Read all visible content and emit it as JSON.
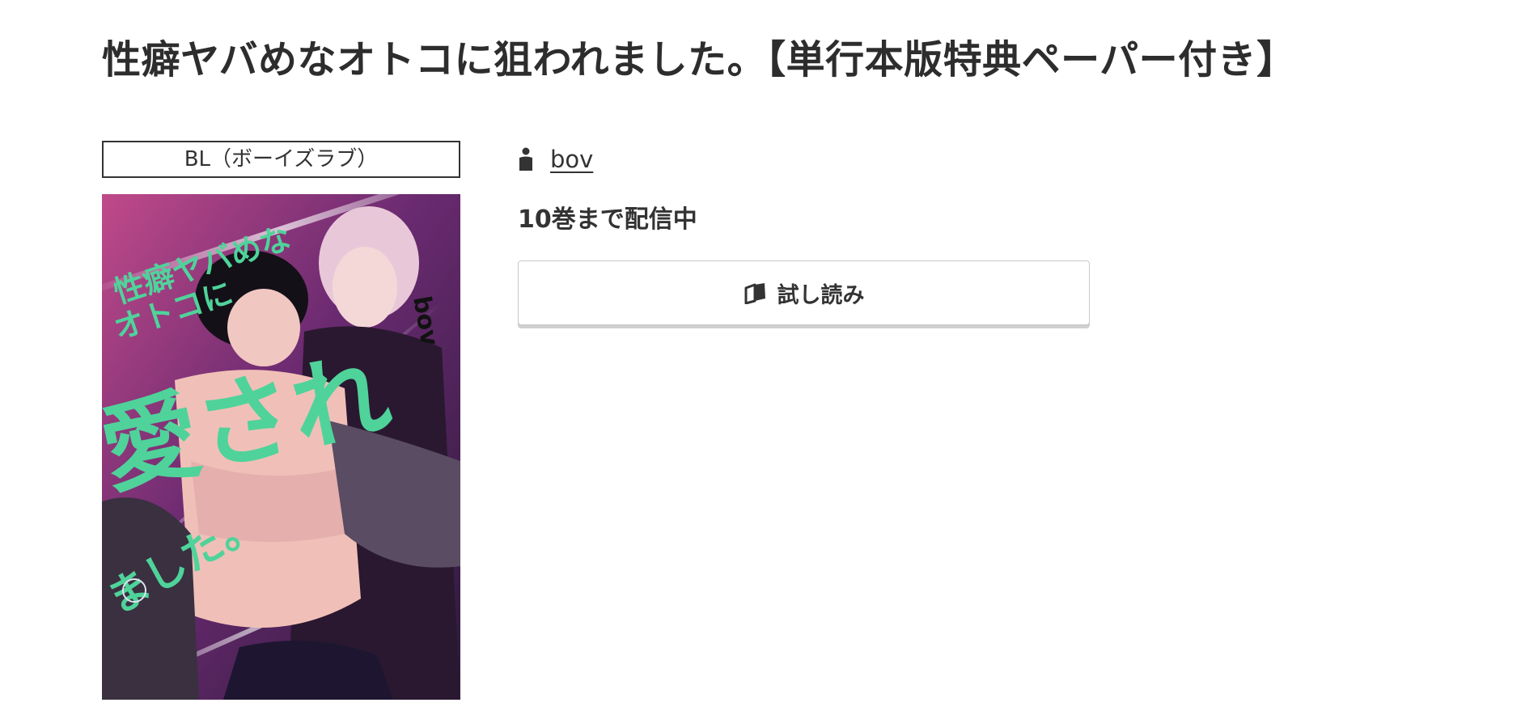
{
  "title": "性癖ヤバめなオトコに狙われました。【単行本版特典ペーパー付き】",
  "genre": "BL（ボーイズラブ）",
  "author": {
    "name": "bov",
    "icon": "person-icon"
  },
  "volume_status": "10巻まで配信中",
  "trial_button": {
    "label": "試し読み",
    "icon": "open-book-icon"
  },
  "cover": {
    "title_lines": [
      "性癖ヤバめな",
      "オトコに",
      "愛され",
      "ました。"
    ],
    "author_text": "bov",
    "accent_color": "#4fd39a"
  },
  "colors": {
    "text": "#333333",
    "cover_accent": "#4fd39a"
  }
}
